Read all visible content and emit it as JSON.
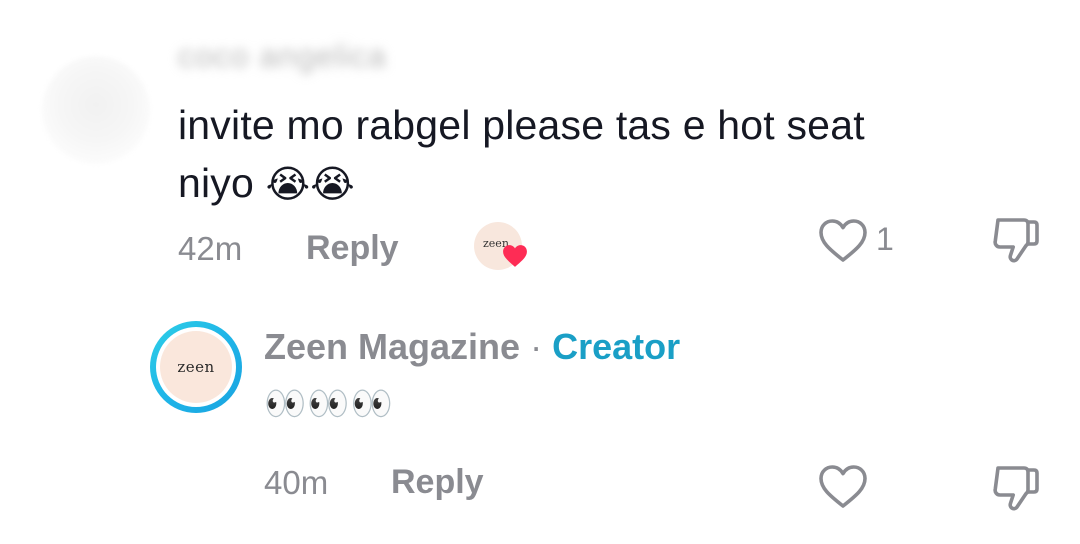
{
  "comment": {
    "username": "coco angelica",
    "text_line1": "invite mo rabgel please tas e hot seat",
    "text_line2": "niyo",
    "emojis": "😭😭",
    "time": "42m",
    "reply_label": "Reply",
    "creator_liked_logo": "zeen",
    "like_count": "1"
  },
  "reply": {
    "author": "Zeen Magazine",
    "separator": "·",
    "badge": "Creator",
    "avatar_logo": "zeen",
    "text": "👀👀👀",
    "time": "40m",
    "reply_label": "Reply"
  },
  "colors": {
    "meta_gray": "#8a8b91",
    "creator_blue": "#1a9fc6",
    "heart_red": "#fe2c55",
    "avatar_ring": "#1fb5e8"
  },
  "icons": [
    "heart-outline-icon",
    "thumbs-down-icon",
    "heart-badge-icon"
  ]
}
